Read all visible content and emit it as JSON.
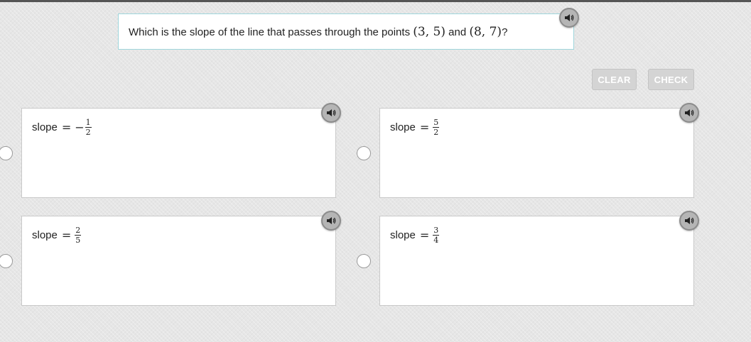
{
  "question": {
    "text_before": "Which is the slope of the line that passes through the points ",
    "point1": "(3, 5)",
    "text_middle": " and ",
    "point2": "(8, 7)",
    "text_after": "?"
  },
  "buttons": {
    "clear_label": "CLEAR",
    "check_label": "CHECK"
  },
  "options": [
    {
      "label": "slope",
      "equals": "=",
      "sign": "−",
      "numerator": "1",
      "denominator": "2"
    },
    {
      "label": "slope",
      "equals": "=",
      "sign": "",
      "numerator": "5",
      "denominator": "2"
    },
    {
      "label": "slope",
      "equals": "=",
      "sign": "",
      "numerator": "2",
      "denominator": "5"
    },
    {
      "label": "slope",
      "equals": "=",
      "sign": "",
      "numerator": "3",
      "denominator": "4"
    }
  ],
  "icons": {
    "audio": "speaker-icon",
    "radio": "radio-button"
  },
  "colors": {
    "background": "#e6e6e6",
    "question_border": "#9fd6dc",
    "button_disabled": "#d4d4d4",
    "audio_button": "#b5b5b5"
  }
}
